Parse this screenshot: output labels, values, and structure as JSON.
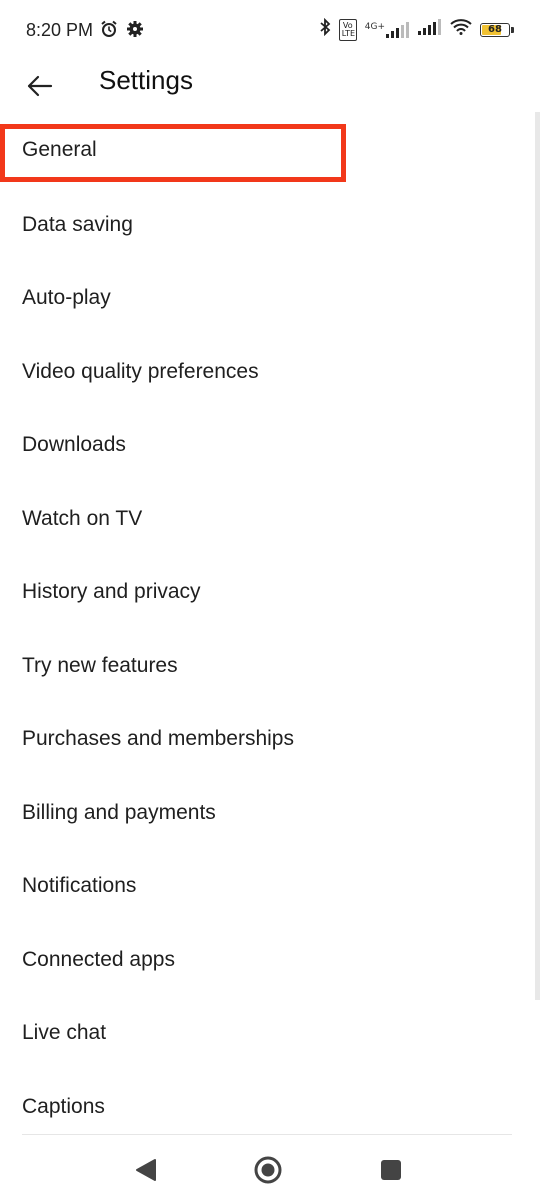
{
  "status_bar": {
    "time": "8:20 PM",
    "icons_left": [
      "alarm-icon",
      "gear-icon"
    ],
    "icons_right": [
      "bluetooth-icon",
      "volte-icon",
      "signal-icon",
      "signal-icon",
      "wifi-icon",
      "battery-icon"
    ],
    "volte_label": "Vo LTE",
    "network_type": "4G+",
    "battery_level": "68",
    "battery_color": "#f1c232"
  },
  "app_bar": {
    "back_icon": "arrow-left-icon",
    "title": "Settings"
  },
  "settings": {
    "items": [
      {
        "label": "General"
      },
      {
        "label": "Data saving"
      },
      {
        "label": "Auto-play"
      },
      {
        "label": "Video quality preferences"
      },
      {
        "label": "Downloads"
      },
      {
        "label": "Watch on TV"
      },
      {
        "label": "History and privacy"
      },
      {
        "label": "Try new features"
      },
      {
        "label": "Purchases and memberships"
      },
      {
        "label": "Billing and payments"
      },
      {
        "label": "Notifications"
      },
      {
        "label": "Connected apps"
      },
      {
        "label": "Live chat"
      },
      {
        "label": "Captions"
      }
    ],
    "highlight_color": "#f2381a"
  },
  "nav_bar": {
    "buttons": [
      "back-triangle-icon",
      "home-circle-icon",
      "recents-square-icon"
    ]
  }
}
